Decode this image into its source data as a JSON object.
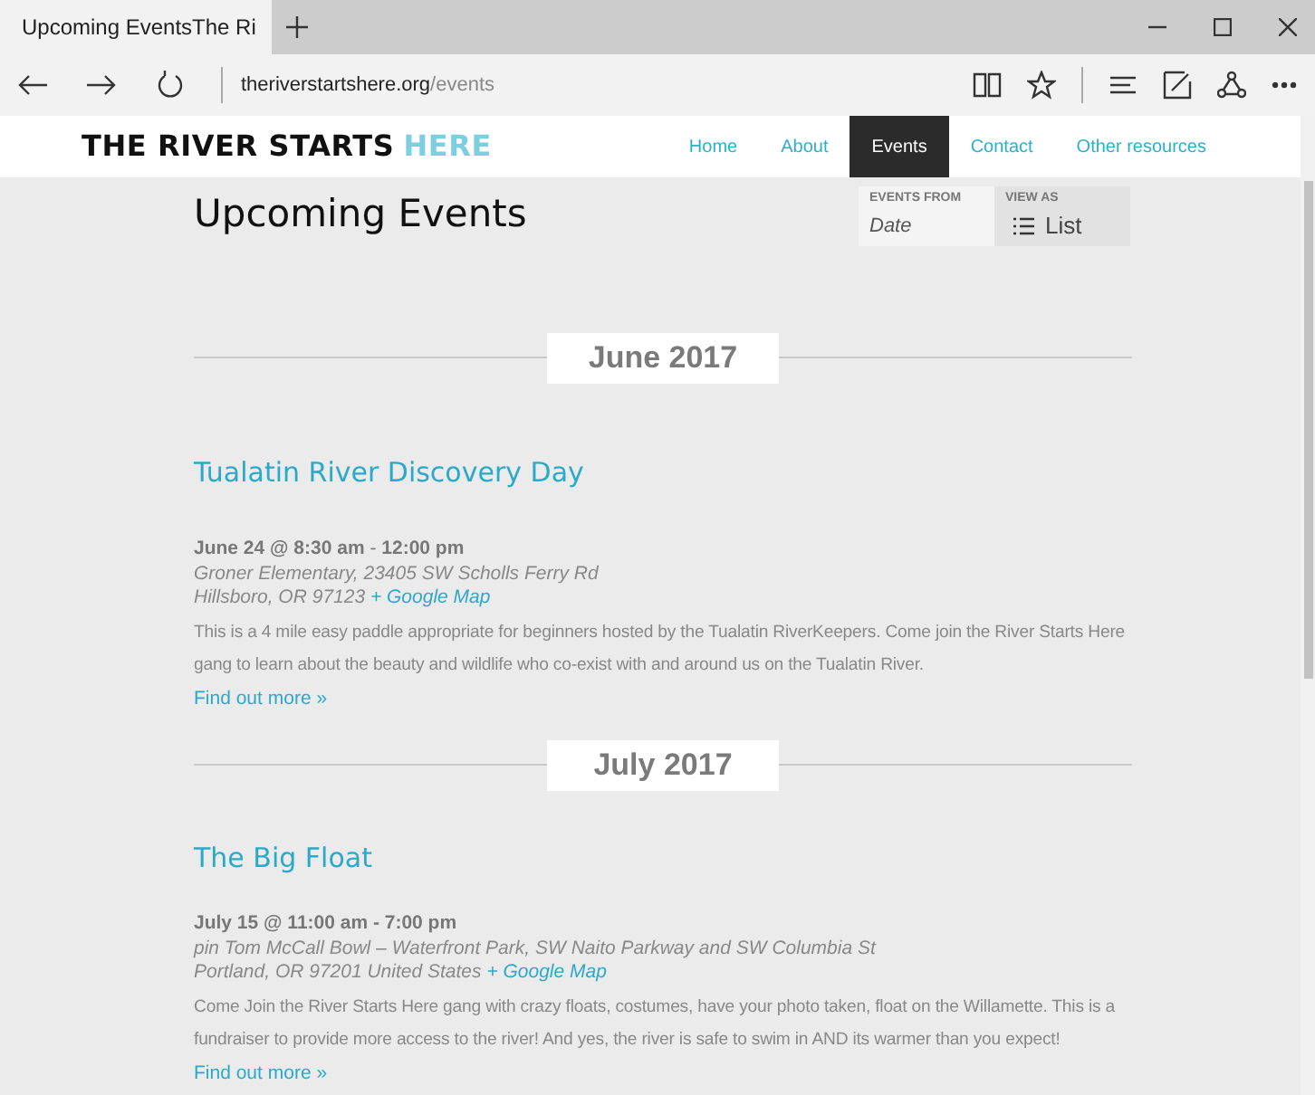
{
  "browser": {
    "tab_title": "Upcoming EventsThe Ri",
    "url_domain": "theriverstartshere.org",
    "url_path": "/events"
  },
  "site": {
    "logo_main": "THE RIVER STARTS",
    "logo_accent": "HERE",
    "nav": [
      {
        "label": "Home",
        "selected": false
      },
      {
        "label": "About",
        "selected": false
      },
      {
        "label": "Events",
        "selected": true
      },
      {
        "label": "Contact",
        "selected": false
      },
      {
        "label": "Other resources",
        "selected": false
      }
    ]
  },
  "page_title": "Upcoming Events",
  "filter": {
    "events_from_label": "EVENTS FROM",
    "events_from_placeholder": "Date",
    "view_as_label": "VIEW AS",
    "view_as_value": "List"
  },
  "months": [
    {
      "label": "June 2017",
      "events": [
        {
          "title": "Tualatin River Discovery Day",
          "datetime": "**June 24 @ 8:30 am** - **12:00 pm**",
          "venue": "Groner Elementary, 23405 SW Scholls Ferry Rd",
          "address": "Hillsboro, OR 97123",
          "map_link": "+ Google Map",
          "description": "This is a 4 mile easy paddle appropriate for beginners hosted by the Tualatin RiverKeepers. Come join the River Starts Here gang to learn about the beauty and wildlife who co-exist with and around us on the Tualatin River.",
          "more_link": "Find out more »"
        }
      ]
    },
    {
      "label": "July 2017",
      "events": [
        {
          "title": "The Big Float",
          "datetime": "**July 15 @ 11:00 am - 7:00 pm**",
          "venue": "pin Tom McCall Bowl – Waterfront Park, SW Naito Parkway and SW Columbia St",
          "address": "Portland, OR 97201 United States",
          "map_link": "+ Google Map",
          "description": "Come Join the River Starts Here gang with crazy floats, costumes, have your photo taken, float on the Willamette. This is a fundraiser to provide more access to the river! And yes, the river is safe to swim in AND its warmer than you expect!",
          "more_link": "Find out more »"
        }
      ]
    }
  ]
}
